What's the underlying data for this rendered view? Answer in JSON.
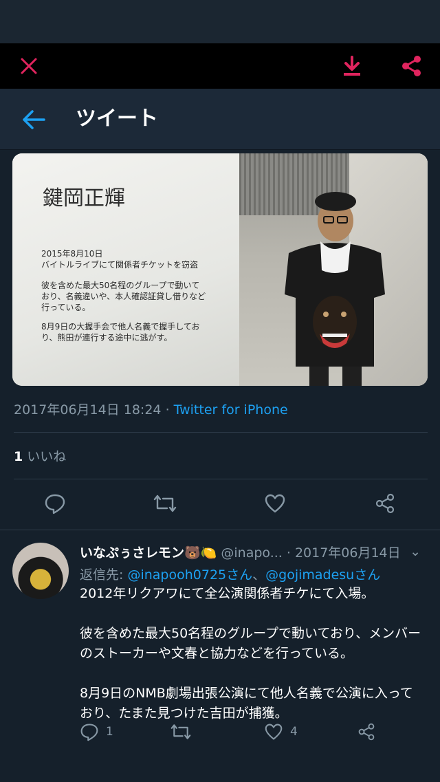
{
  "header": {
    "title": "ツイート"
  },
  "image_text": {
    "name": "鍵岡正輝",
    "para1": "2015年8月10日\nバイトルライブにて関係者チケットを窃盗",
    "para2": "彼を含めた最大50名程のグループで動いて\nおり、名義違いや、本人確認証貸し借りなど\n行っている。",
    "para3": "8月9日の大握手会で他人名義で握手してお\nり、熊田が連行する途中に逃がす。"
  },
  "tweet_meta": {
    "timestamp": "2017年06月14日 18:24",
    "separator": "·",
    "source": "Twitter for iPhone"
  },
  "likes": {
    "count": "1",
    "label": "いいね"
  },
  "reply": {
    "display_name": "いなぷぅさレモン🐻🍋",
    "handle": "@inapo...",
    "date": "· 2017年06月14日",
    "caret": "⌄",
    "reply_to_prefix": "返信先: ",
    "mention1": "@inapooh0725さん",
    "joiner": "、",
    "mention2": "@gojimadesuさん",
    "body": [
      "2012年リクアワにて全公演関係者チケにて入場。",
      "彼を含めた最大50名程のグループで動いており、メンバーのストーカーや文春と協力などを行っている。",
      "8月9日のNMB劇場出張公演にて他人名義で公演に入っており、たまた見つけた吉田が捕獲。"
    ],
    "reply_count": "1",
    "like_count": "4"
  },
  "colors": {
    "background": "#15202b",
    "accent": "#1da1f2",
    "viewer_icon": "#e0245e",
    "muted": "#8899a6"
  },
  "icons": [
    "close-icon",
    "download-icon",
    "share-icon",
    "back-arrow-icon",
    "reply-icon",
    "retweet-icon",
    "like-icon",
    "share-tweet-icon"
  ]
}
